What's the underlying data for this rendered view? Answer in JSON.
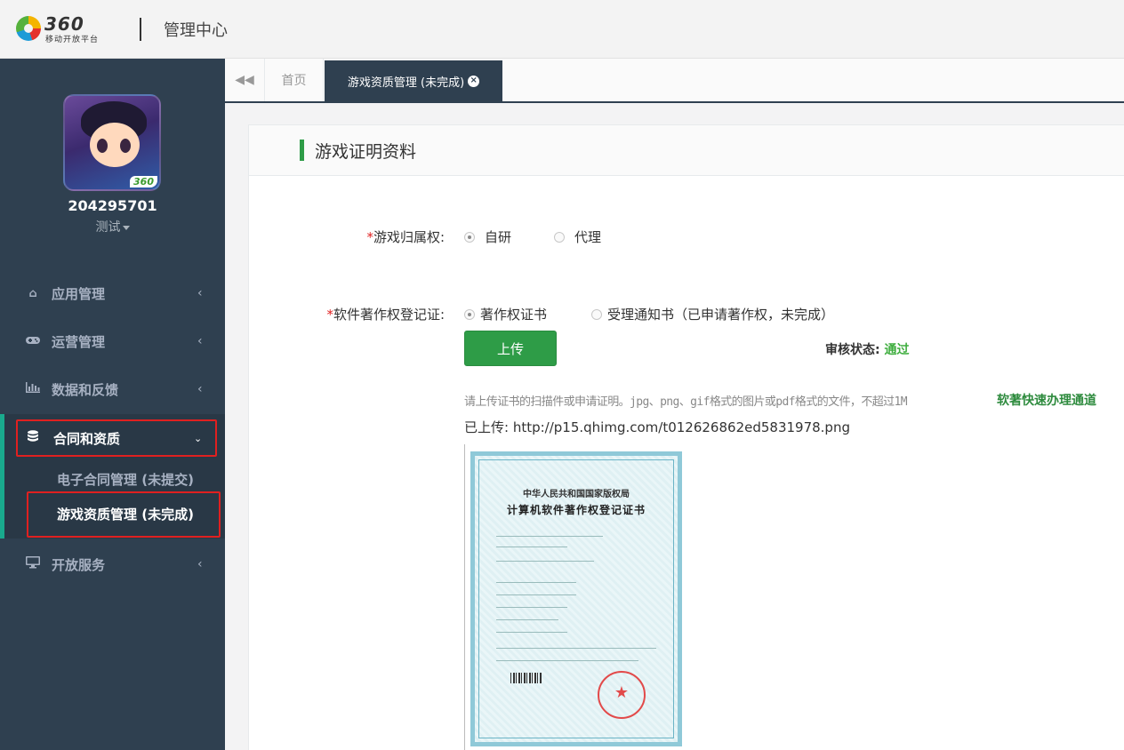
{
  "header": {
    "logo_num": "360",
    "logo_sub": "移动开放平台",
    "title": "管理中心"
  },
  "user": {
    "id": "204295701",
    "role": "测试",
    "avatar_badge": "360"
  },
  "sidebar": {
    "items": [
      {
        "label": "应用管理",
        "icon": "home-icon"
      },
      {
        "label": "运营管理",
        "icon": "gamepad-icon"
      },
      {
        "label": "数据和反馈",
        "icon": "bar-chart-icon"
      },
      {
        "label": "合同和资质",
        "icon": "database-icon"
      },
      {
        "label": "开放服务",
        "icon": "desktop-icon"
      }
    ],
    "sub_items": [
      {
        "label": "电子合同管理 (未提交)"
      },
      {
        "label": "游戏资质管理 (未完成)"
      }
    ]
  },
  "tabs": {
    "home": "首页",
    "current": "游戏资质管理 (未完成)"
  },
  "panel": {
    "title": "游戏证明资料"
  },
  "form": {
    "ownership": {
      "label": "游戏归属权:",
      "required_mark": "*",
      "options": [
        "自研",
        "代理"
      ],
      "selected": "自研"
    },
    "copyright": {
      "label": "软件著作权登记证:",
      "required_mark": "*",
      "options": [
        "著作权证书",
        "受理通知书（已申请著作权，未完成）"
      ],
      "selected": "著作权证书"
    },
    "upload_label": "上传",
    "review_label": "审核状态:",
    "review_status": "通过",
    "hint": "请上传证书的扫描件或申请证明。jpg、png、gif格式的图片或pdf格式的文件，不超过1M",
    "fast_link": "软著快速办理通道",
    "uploaded": "已上传: http://p15.qhimg.com/t012626862ed5831978.png"
  },
  "certificate": {
    "issuer": "中华人民共和国国家版权局",
    "title": "计算机软件著作权登记证书"
  },
  "colors": {
    "sidebar_bg": "#2f4050",
    "accent_green": "#2e9c47",
    "status_green": "#3fae3f",
    "highlight_red": "#e02020"
  }
}
